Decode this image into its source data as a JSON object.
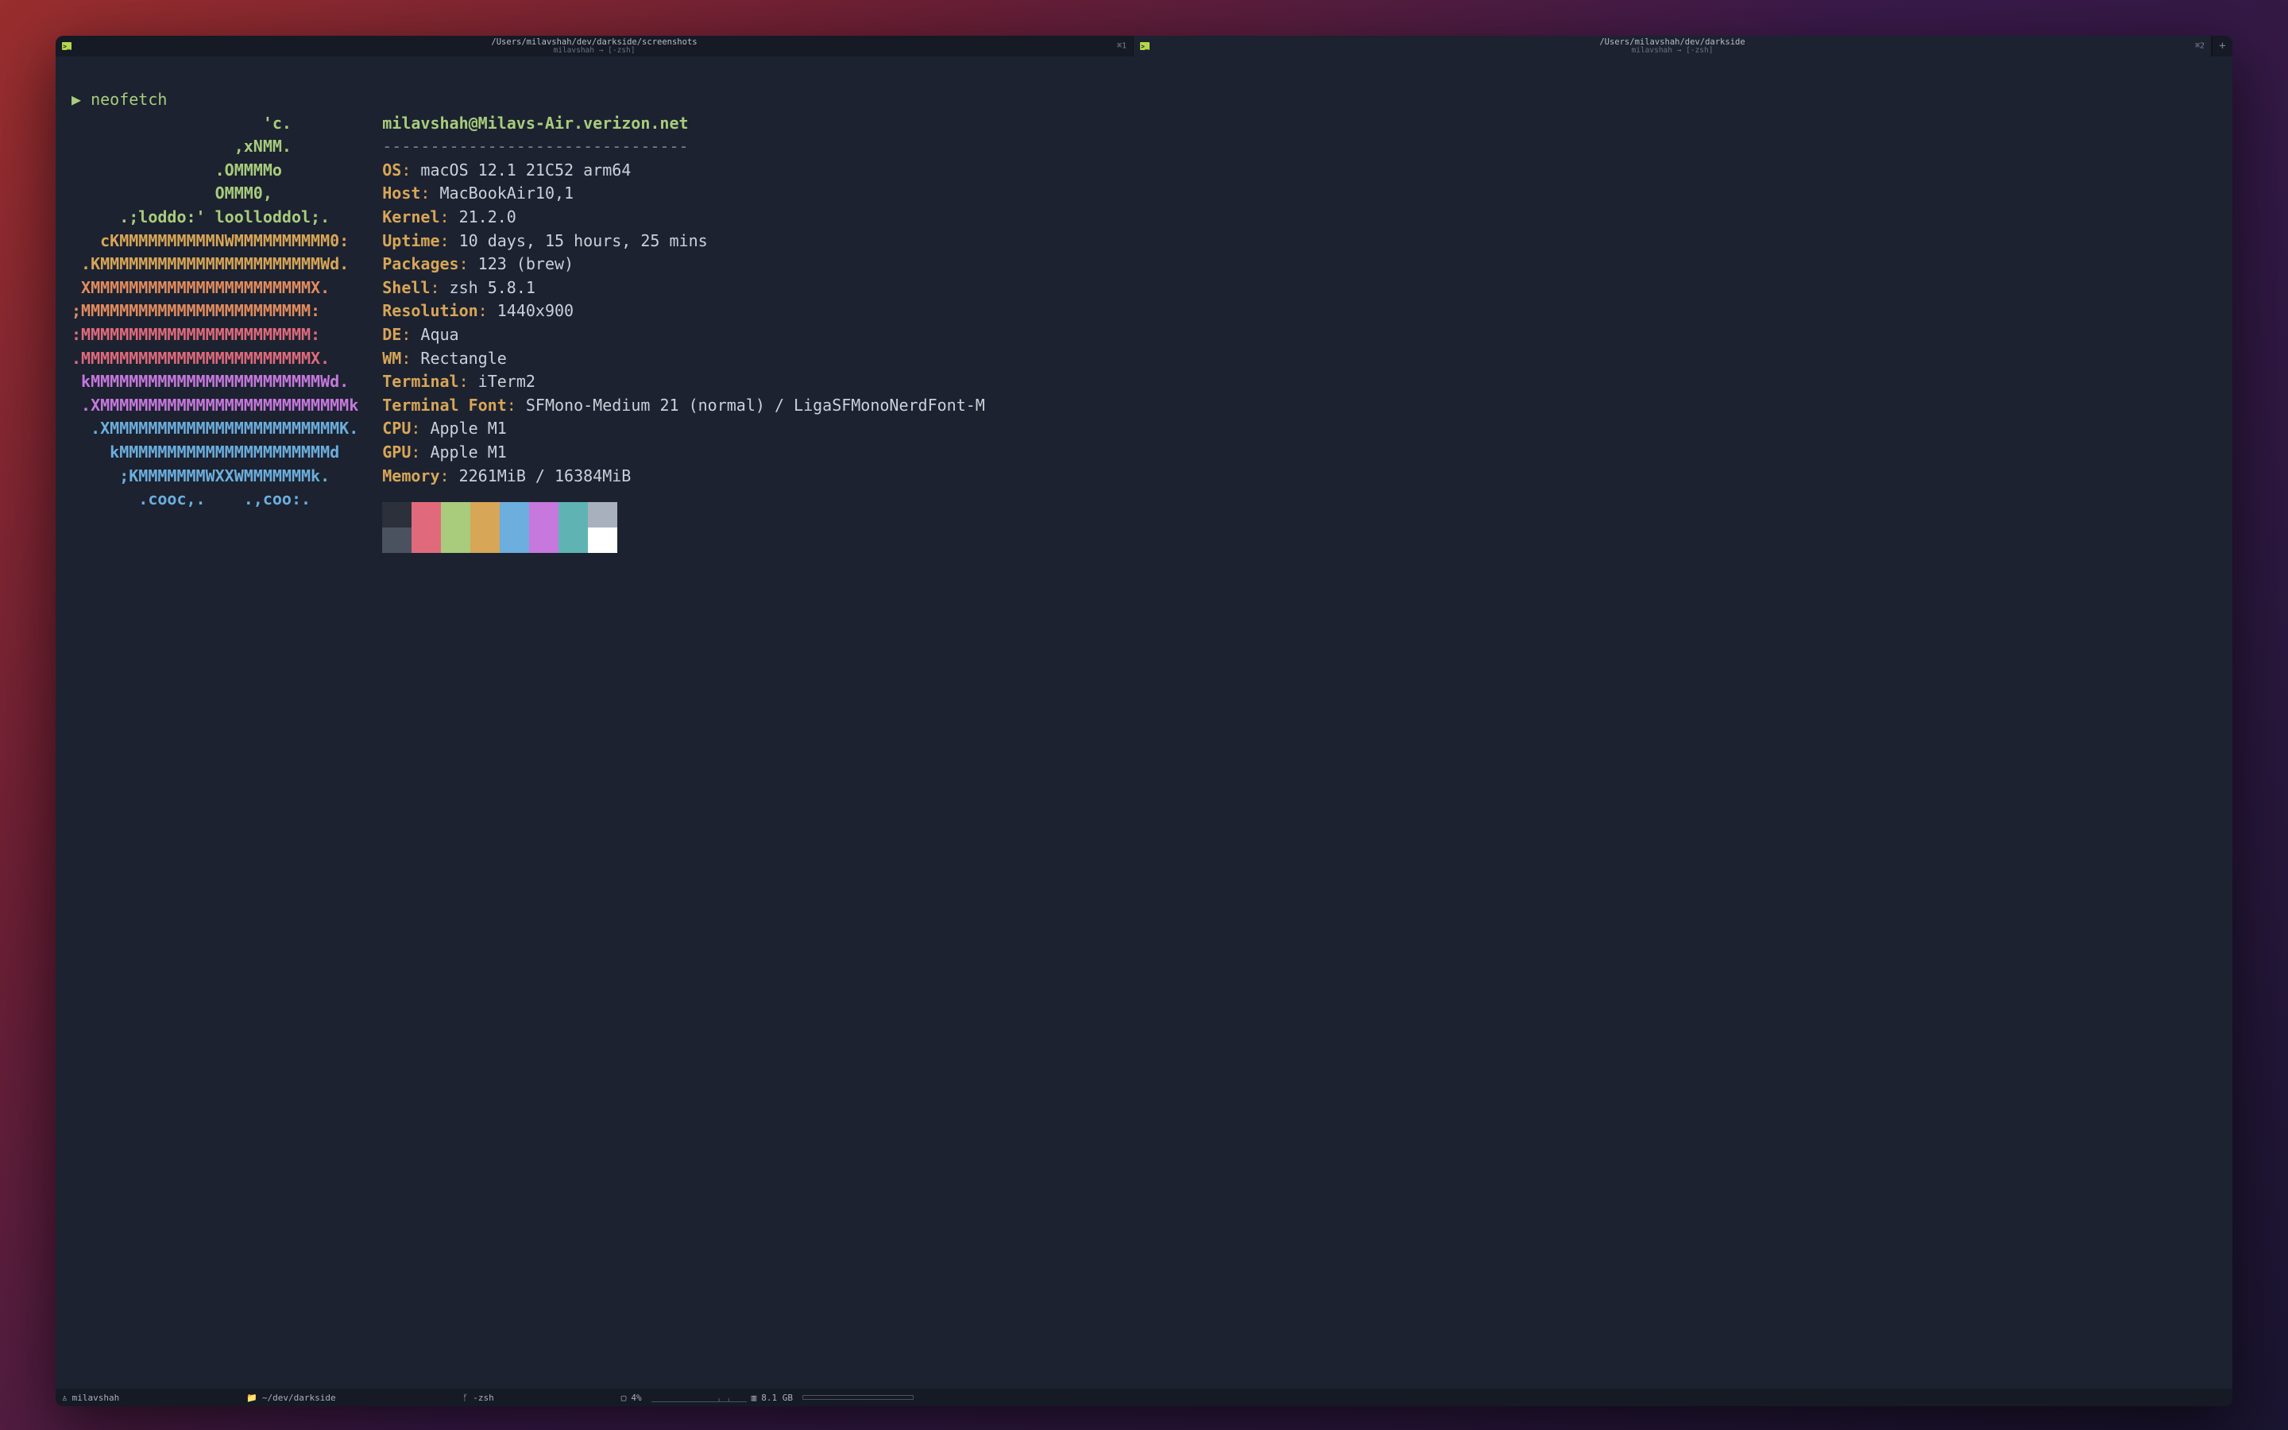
{
  "tabs": [
    {
      "path": "/Users/milavshah/dev/darkside/screenshots",
      "sub": "milavshah → [-zsh]",
      "shortcut": "⌘1",
      "active": false
    },
    {
      "path": "/Users/milavshah/dev/darkside",
      "sub": "milavshah → [-zsh]",
      "shortcut": "⌘2",
      "active": true
    }
  ],
  "prompt": {
    "symbol": "▶",
    "command": "neofetch"
  },
  "ascii": {
    "lines": [
      {
        "text": "                    'c.",
        "color": "c-green"
      },
      {
        "text": "                 ,xNMM.",
        "color": "c-green"
      },
      {
        "text": "               .OMMMMo",
        "color": "c-green"
      },
      {
        "text": "               OMMM0,",
        "color": "c-green"
      },
      {
        "text": "     .;loddo:' loolloddol;.",
        "color": "c-green"
      },
      {
        "text": "   cKMMMMMMMMMMNWMMMMMMMMMM0:",
        "color": "c-yellow"
      },
      {
        "text": " .KMMMMMMMMMMMMMMMMMMMMMMMWd.",
        "color": "c-yellow"
      },
      {
        "text": " XMMMMMMMMMMMMMMMMMMMMMMMX.",
        "color": "c-orange"
      },
      {
        "text": ";MMMMMMMMMMMMMMMMMMMMMMMM:",
        "color": "c-orange"
      },
      {
        "text": ":MMMMMMMMMMMMMMMMMMMMMMMM:",
        "color": "c-red"
      },
      {
        "text": ".MMMMMMMMMMMMMMMMMMMMMMMMX.",
        "color": "c-red"
      },
      {
        "text": " kMMMMMMMMMMMMMMMMMMMMMMMMWd.",
        "color": "c-pink"
      },
      {
        "text": " .XMMMMMMMMMMMMMMMMMMMMMMMMMMk",
        "color": "c-pink"
      },
      {
        "text": "  .XMMMMMMMMMMMMMMMMMMMMMMMMK.",
        "color": "c-blue"
      },
      {
        "text": "    kMMMMMMMMMMMMMMMMMMMMMMd",
        "color": "c-blue"
      },
      {
        "text": "     ;KMMMMMMMWXXWMMMMMMMk.",
        "color": "c-blue"
      },
      {
        "text": "       .cooc,.    .,coo:.",
        "color": "c-blue"
      }
    ]
  },
  "neofetch": {
    "header": "milavshah@Milavs-Air.verizon.net",
    "separator": "--------------------------------",
    "rows": [
      {
        "label": "OS",
        "value": "macOS 12.1 21C52 arm64"
      },
      {
        "label": "Host",
        "value": "MacBookAir10,1"
      },
      {
        "label": "Kernel",
        "value": "21.2.0"
      },
      {
        "label": "Uptime",
        "value": "10 days, 15 hours, 25 mins"
      },
      {
        "label": "Packages",
        "value": "123 (brew)"
      },
      {
        "label": "Shell",
        "value": "zsh 5.8.1"
      },
      {
        "label": "Resolution",
        "value": "1440x900"
      },
      {
        "label": "DE",
        "value": "Aqua"
      },
      {
        "label": "WM",
        "value": "Rectangle"
      },
      {
        "label": "Terminal",
        "value": "iTerm2"
      },
      {
        "label": "Terminal Font",
        "value": "SFMono-Medium 21 (normal) / LigaSFMonoNerdFont-M"
      },
      {
        "label": "CPU",
        "value": "Apple M1"
      },
      {
        "label": "GPU",
        "value": "Apple M1"
      },
      {
        "label": "Memory",
        "value": "2261MiB / 16384MiB"
      }
    ]
  },
  "palette": {
    "row1": [
      "#2b303b",
      "#e06a7c",
      "#a8cc7c",
      "#d8a657",
      "#6caedd",
      "#c678dd",
      "#5fb3b3",
      "#a8b0bd"
    ],
    "row2": [
      "#4a5260",
      "#e06a7c",
      "#a8cc7c",
      "#d8a657",
      "#6caedd",
      "#c678dd",
      "#5fb3b3",
      "#ffffff"
    ]
  },
  "statusbar": {
    "user": "milavshah",
    "cwd": "~/dev/darkside",
    "proc": "-zsh",
    "cpu": "4%",
    "mem": "8.1 GB"
  },
  "newtab": "+"
}
